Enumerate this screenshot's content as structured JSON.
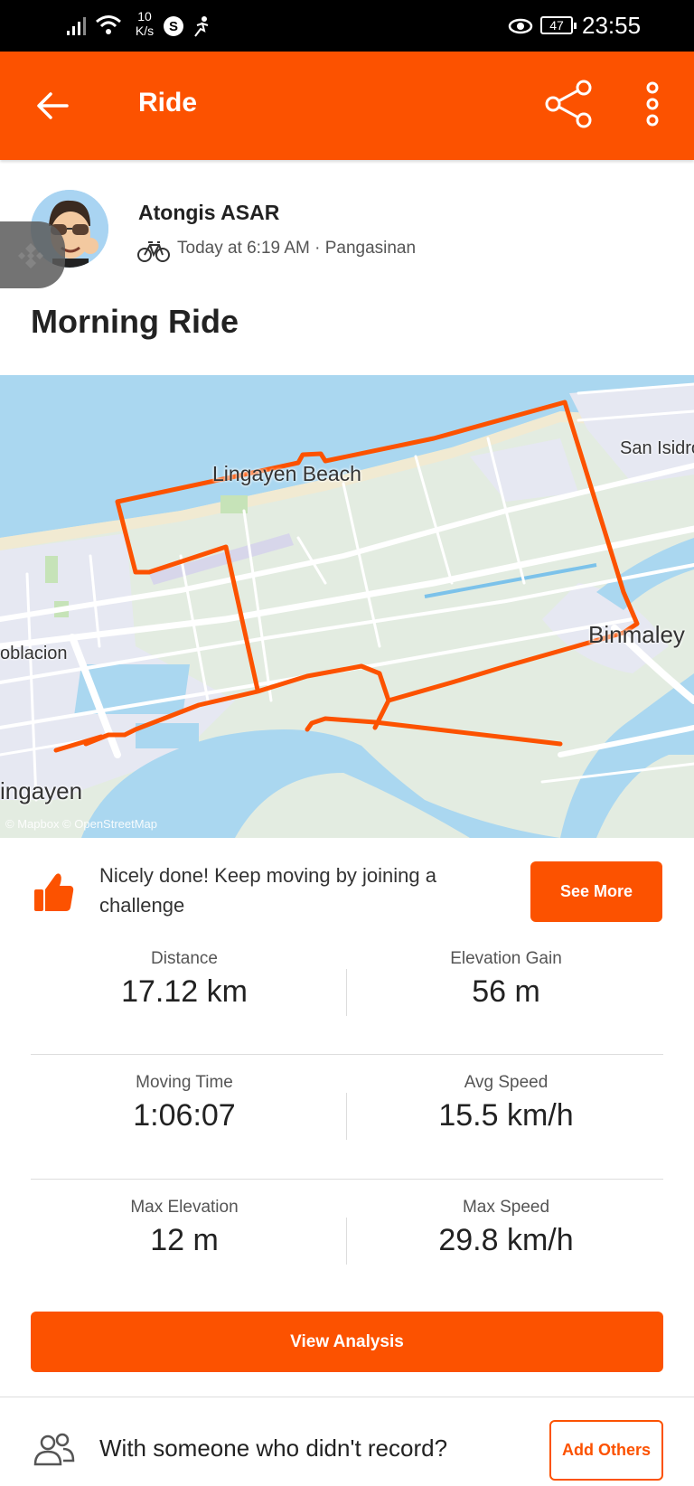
{
  "status_bar": {
    "net_speed_value": "10",
    "net_speed_unit": "K/s",
    "battery": "47",
    "time": "23:55"
  },
  "app_bar": {
    "title": "Ride"
  },
  "athlete": {
    "name": "Atongis ASAR",
    "meta": "Today at 6:19 AM · Pangasinan",
    "activity_icon": "bike-icon"
  },
  "activity": {
    "title": "Morning Ride"
  },
  "map": {
    "labels": [
      "Lingayen Beach",
      "San Isidro",
      "Binmaley",
      "oblacion",
      "ingayen"
    ],
    "attribution": "© Mapbox © OpenStreetMap",
    "route_color": "#fc5200",
    "water_color": "#aad7f0"
  },
  "challenge": {
    "text": "Nicely done! Keep moving by joining a challenge",
    "button": "See More"
  },
  "stats": [
    {
      "label": "Distance",
      "value": "17.12 km"
    },
    {
      "label": "Elevation Gain",
      "value": "56 m"
    },
    {
      "label": "Moving Time",
      "value": "1:06:07"
    },
    {
      "label": "Avg Speed",
      "value": "15.5 km/h"
    },
    {
      "label": "Max Elevation",
      "value": "12 m"
    },
    {
      "label": "Max Speed",
      "value": "29.8 km/h"
    }
  ],
  "analysis_button": "View Analysis",
  "footer": {
    "text": "With someone who didn't record?",
    "button": "Add Others"
  },
  "colors": {
    "brand": "#fc5200"
  }
}
